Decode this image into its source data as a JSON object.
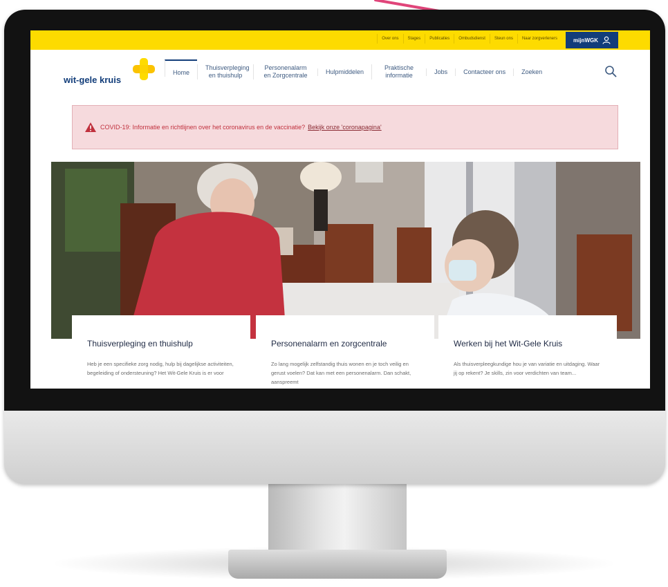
{
  "colors": {
    "brand_yellow": "#fddb00",
    "brand_blue": "#123d7a",
    "alert_bg": "#f6dadd",
    "alert_text": "#c0303d",
    "arrow": "#e0457a"
  },
  "topbar": {
    "links": [
      "Over ons",
      "Stages",
      "Publicaties",
      "Ombudsdienst",
      "Steun ons",
      "Naar zorgverleners"
    ],
    "mijn_label": "mijnWGK",
    "mijn_icon": "user-icon"
  },
  "logo": {
    "text": "wit-gele kruis",
    "icon": "cross-logo-icon"
  },
  "nav": {
    "items": [
      {
        "label": "Home"
      },
      {
        "label": "Thuisverpleging en thuishulp"
      },
      {
        "label": "Personenalarm en Zorgcentrale"
      },
      {
        "label": "Hulpmiddelen"
      },
      {
        "label": "Praktische informatie"
      },
      {
        "label": "Jobs"
      },
      {
        "label": "Contacteer ons"
      },
      {
        "label": "Zoeken"
      }
    ],
    "search_icon": "search-icon"
  },
  "alert": {
    "text": "COVID-19: Informatie en richtlijnen over het coronavirus en de vaccinatie?",
    "link": "Bekijk onze 'coronapagina'",
    "icon": "warning-icon"
  },
  "cards": [
    {
      "title": "Thuisverpleging en thuishulp",
      "text": "Heb je een specifieke zorg nodig, hulp bij dagelijkse activiteiten, begeleiding of ondersteuning? Het Wit-Gele Kruis is er voor"
    },
    {
      "title": "Personenalarm en zorgcentrale",
      "text": "Zo lang mogelijk zelfstandig thuis wonen en je toch veilig en gerust voelen? Dat kan met een personenalarm. Dan schakt, aanspreemt"
    },
    {
      "title": "Werken bij het Wit-Gele Kruis",
      "text": "Als thuisverpleegkundige hou je van variatie en uitdaging. Waar jij op rekent? Je skills, zin voor verdichten van team..."
    }
  ]
}
